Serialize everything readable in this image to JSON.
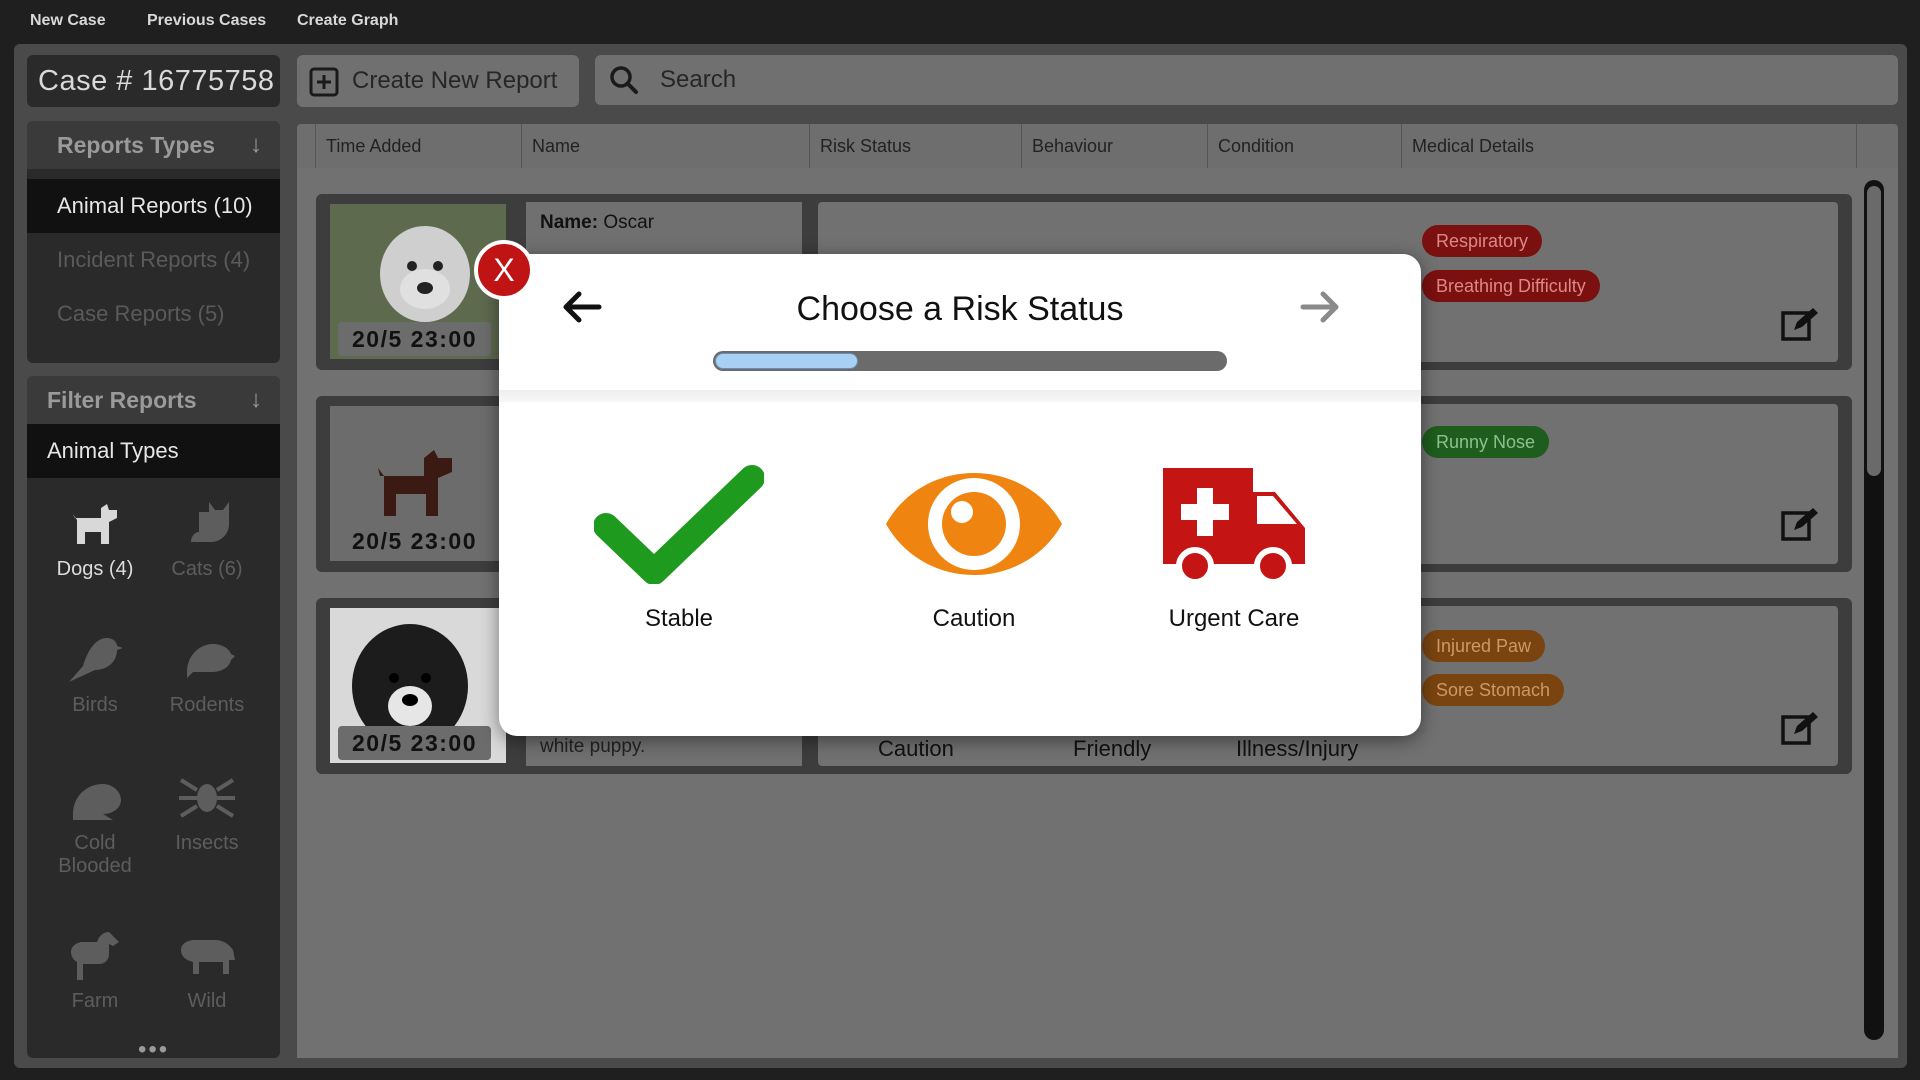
{
  "topbar": {
    "items": [
      "New Case",
      "Previous Cases",
      "Create Graph"
    ]
  },
  "case": {
    "label": "Case # 16775758"
  },
  "toolbar": {
    "create_label": "Create New Report",
    "search_placeholder": "Search"
  },
  "report_types": {
    "title": "Reports Types",
    "items": [
      {
        "label": "Animal Reports (10)",
        "active": true
      },
      {
        "label": "Incident Reports (4)",
        "active": false
      },
      {
        "label": "Case Reports (5)",
        "active": false
      }
    ]
  },
  "filter": {
    "title": "Filter Reports",
    "subtitle": "Animal Types",
    "animals": [
      {
        "label": "Dogs",
        "count": "(4)",
        "icon": "dog-icon",
        "active": true
      },
      {
        "label": "Cats",
        "count": "(6)",
        "icon": "cat-icon",
        "active": false
      },
      {
        "label": "Birds",
        "count": "",
        "icon": "bird-icon",
        "active": false
      },
      {
        "label": "Rodents",
        "count": "",
        "icon": "rodent-icon",
        "active": false
      },
      {
        "label": "Cold Blooded",
        "count": "",
        "icon": "frog-icon",
        "active": false
      },
      {
        "label": "Insects",
        "count": "",
        "icon": "spider-icon",
        "active": false
      },
      {
        "label": "Farm",
        "count": "",
        "icon": "horse-icon",
        "active": false
      },
      {
        "label": "Wild",
        "count": "",
        "icon": "hippo-icon",
        "active": false
      }
    ],
    "more": "•••"
  },
  "table": {
    "columns": [
      "Time Added",
      "Name",
      "Risk Status",
      "Behaviour",
      "Condition",
      "Medical Details"
    ]
  },
  "rows": [
    {
      "date": "20/5 23:00",
      "name_label": "Name:",
      "name_value": "Oscar",
      "tags": [
        {
          "text": "Respiratory",
          "color": "red"
        },
        {
          "text": "Breathing Difficulty",
          "color": "red"
        }
      ]
    },
    {
      "date": "20/5 23:00",
      "name_label": "",
      "name_value": "",
      "tags": [
        {
          "text": "Runny Nose",
          "color": "green"
        }
      ]
    },
    {
      "date": "20/5 23:00",
      "name_label": "",
      "name_value": "white puppy.",
      "tags": [
        {
          "text": "Injured Paw",
          "color": "orange"
        },
        {
          "text": "Sore Stomach",
          "color": "orange"
        }
      ],
      "partial_text": [
        "Caution",
        "Friendly",
        "Illness/Injury"
      ]
    }
  ],
  "modal": {
    "title": "Choose a Risk Status",
    "progress": 0.28,
    "close_label": "X",
    "options": [
      {
        "label": "Stable",
        "icon": "checkmark-icon",
        "color": "#1e9a1e"
      },
      {
        "label": "Caution",
        "icon": "eye-icon",
        "color": "#f08410"
      },
      {
        "label": "Urgent Care",
        "icon": "ambulance-icon",
        "color": "#c41414"
      }
    ]
  }
}
